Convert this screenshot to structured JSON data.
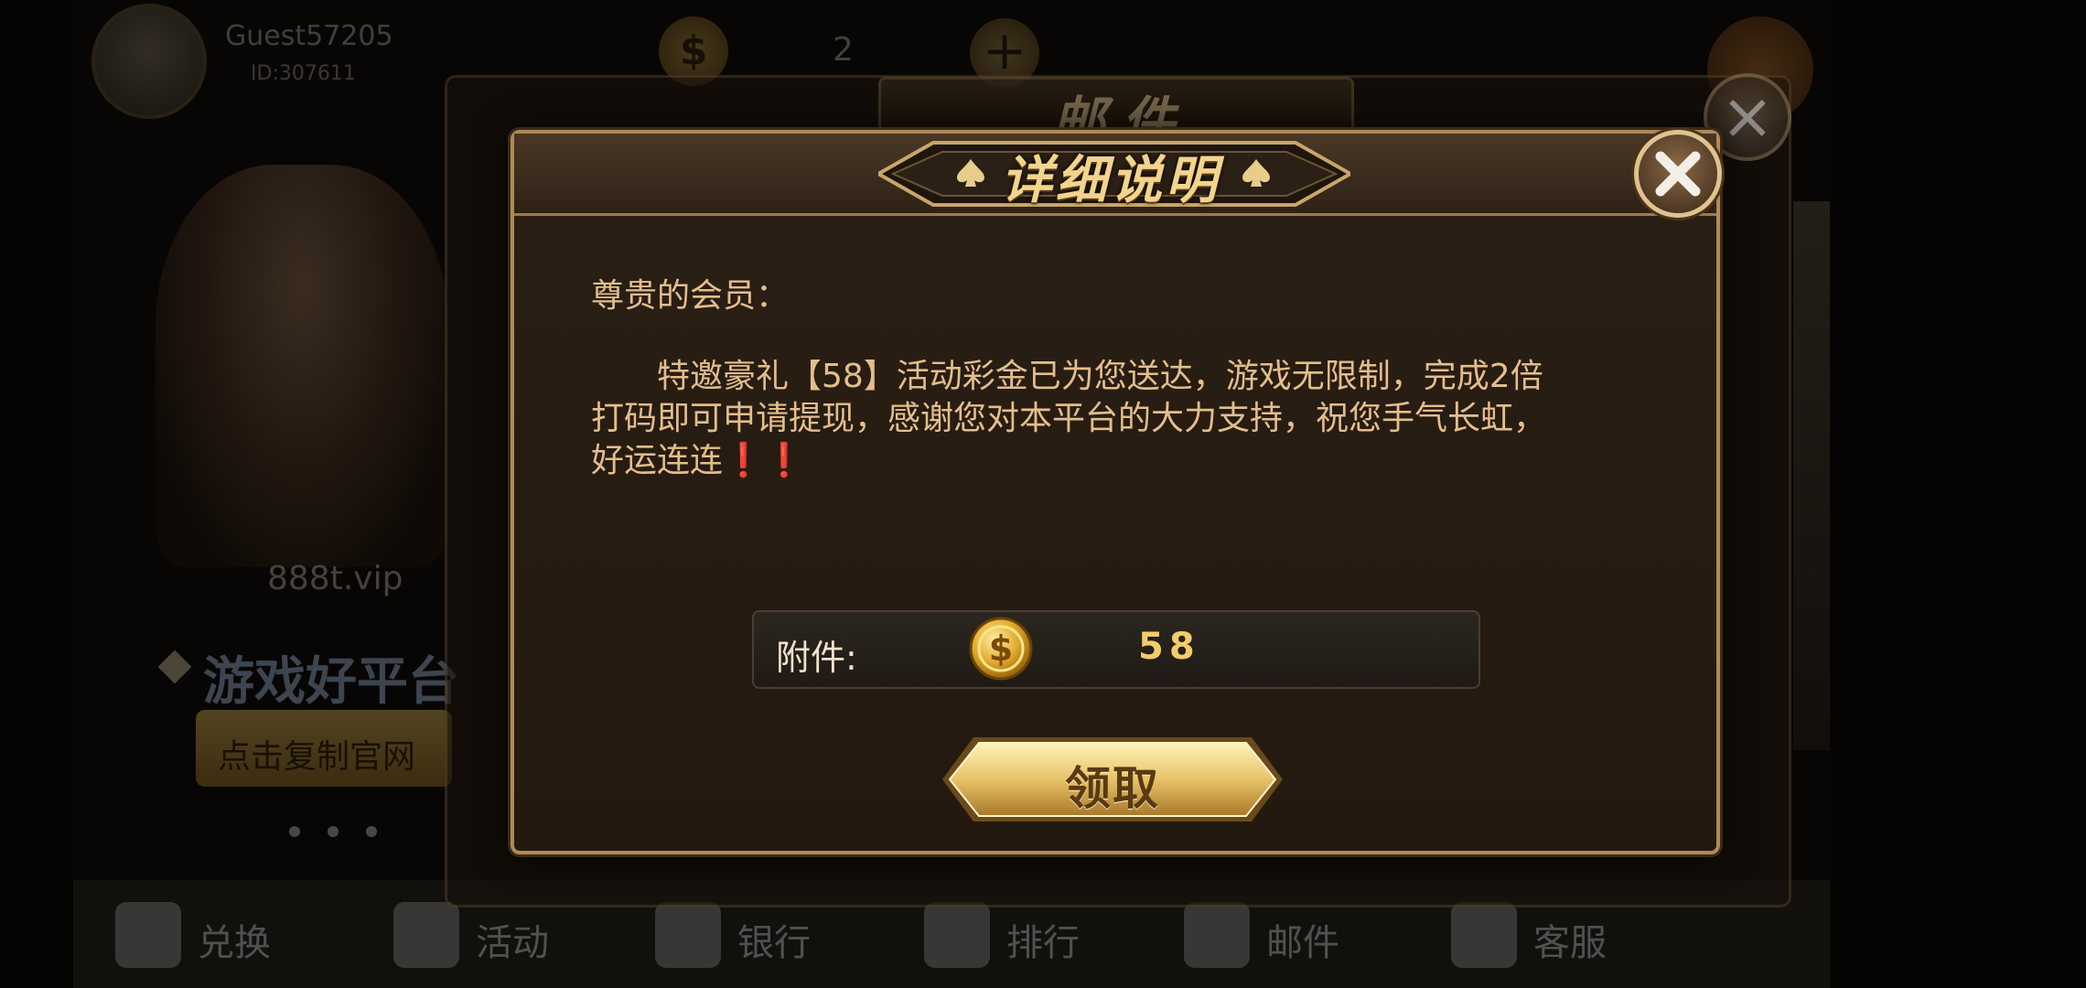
{
  "background": {
    "user": {
      "name": "Guest57205",
      "id": "ID:307611"
    },
    "top_count": "2",
    "vip_site": "888t.vip",
    "promo_text": "游戏好平台",
    "copy_button_label": "点击复制官网",
    "mail_dialog_title": "邮件",
    "bottom_nav": [
      {
        "label": "兑换",
        "icon": "exchange-icon"
      },
      {
        "label": "活动",
        "icon": "gift-icon"
      },
      {
        "label": "银行",
        "icon": "safe-icon"
      },
      {
        "label": "排行",
        "icon": "trophy-icon"
      },
      {
        "label": "邮件",
        "icon": "mail-icon"
      },
      {
        "label": "客服",
        "icon": "support-icon"
      }
    ]
  },
  "dialog": {
    "title": "详细说明",
    "greeting": "尊贵的会员：",
    "body_lines": [
      "　　特邀豪礼【58】活动彩金已为您送达，游戏无限制，完成2倍",
      "打码即可申请提现，感谢您对本平台的大力支持，祝您手气长虹，",
      "好运连连"
    ],
    "exclamations": "❗❗",
    "attachment_label": "附件:",
    "attachment_amount": "58",
    "claim_button_label": "领取",
    "close_icon": "close-icon",
    "coin_icon": "dollar-coin-icon"
  },
  "colors": {
    "dialog_border": "#b08a57",
    "text": "#e4bd8c",
    "title_gold": "#f2d48e",
    "amount_gold": "#f2cd6a",
    "exclamation_red": "#e12a2a"
  }
}
